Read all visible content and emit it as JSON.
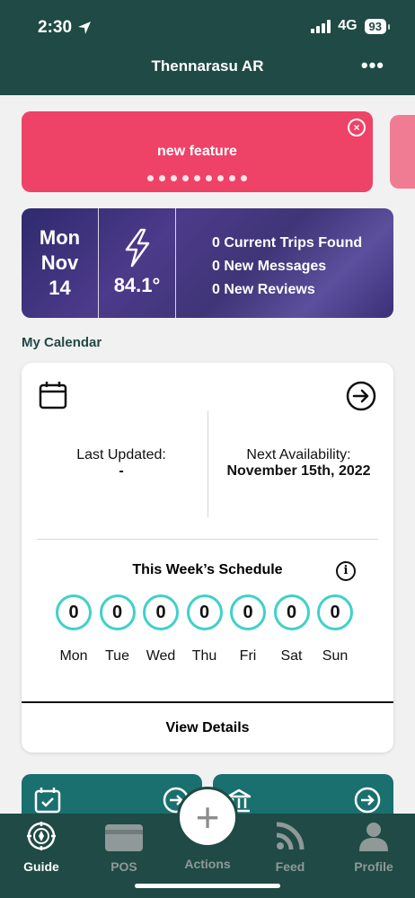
{
  "status_bar": {
    "time": "2:30",
    "network": "4G",
    "battery": "93"
  },
  "header": {
    "title": "Thennarasu AR",
    "more_label": "•••"
  },
  "banner": {
    "text": "new feature",
    "close_label": "×",
    "dot_count": 9
  },
  "info_strip": {
    "day": "Mon",
    "month": "Nov",
    "date": "14",
    "temperature": "84.1°",
    "trips": "0 Current Trips Found",
    "messages": "0 New Messages",
    "reviews": "0 New Reviews"
  },
  "calendar": {
    "section_title": "My Calendar",
    "last_updated_label": "Last Updated:",
    "last_updated_value": "-",
    "next_label": "Next Availability:",
    "next_value": "November 15th, 2022",
    "schedule_title": "This Week’s Schedule",
    "info_label": "i",
    "days": [
      {
        "name": "Mon",
        "count": "0"
      },
      {
        "name": "Tue",
        "count": "0"
      },
      {
        "name": "Wed",
        "count": "0"
      },
      {
        "name": "Thu",
        "count": "0"
      },
      {
        "name": "Fri",
        "count": "0"
      },
      {
        "name": "Sat",
        "count": "0"
      },
      {
        "name": "Sun",
        "count": "0"
      }
    ],
    "view_details": "View Details"
  },
  "tabbar": {
    "guide": "Guide",
    "pos": "POS",
    "actions": "Actions",
    "feed": "Feed",
    "profile": "Profile",
    "fab_label": "+"
  },
  "colors": {
    "header": "#1f4a45",
    "banner": "#ee4267",
    "ring": "#3fd1c9",
    "tile": "#1a6f6f"
  }
}
